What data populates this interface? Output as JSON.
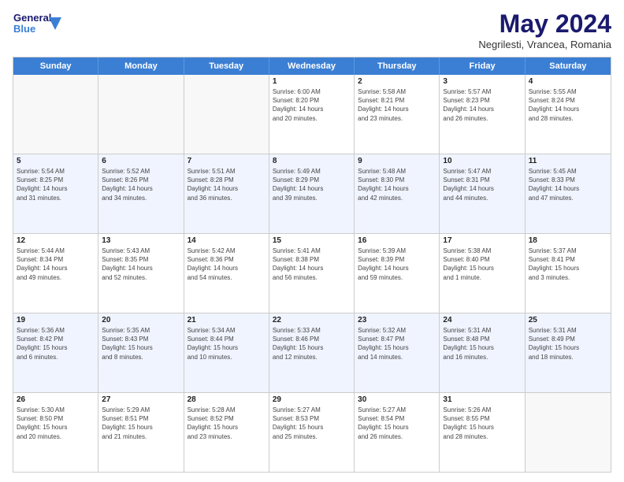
{
  "logo": {
    "line1": "General",
    "line2": "Blue"
  },
  "title": "May 2024",
  "subtitle": "Negrilesti, Vrancea, Romania",
  "days": [
    "Sunday",
    "Monday",
    "Tuesday",
    "Wednesday",
    "Thursday",
    "Friday",
    "Saturday"
  ],
  "weeks": [
    [
      {
        "date": "",
        "info": ""
      },
      {
        "date": "",
        "info": ""
      },
      {
        "date": "",
        "info": ""
      },
      {
        "date": "1",
        "info": "Sunrise: 6:00 AM\nSunset: 8:20 PM\nDaylight: 14 hours\nand 20 minutes."
      },
      {
        "date": "2",
        "info": "Sunrise: 5:58 AM\nSunset: 8:21 PM\nDaylight: 14 hours\nand 23 minutes."
      },
      {
        "date": "3",
        "info": "Sunrise: 5:57 AM\nSunset: 8:23 PM\nDaylight: 14 hours\nand 26 minutes."
      },
      {
        "date": "4",
        "info": "Sunrise: 5:55 AM\nSunset: 8:24 PM\nDaylight: 14 hours\nand 28 minutes."
      }
    ],
    [
      {
        "date": "5",
        "info": "Sunrise: 5:54 AM\nSunset: 8:25 PM\nDaylight: 14 hours\nand 31 minutes."
      },
      {
        "date": "6",
        "info": "Sunrise: 5:52 AM\nSunset: 8:26 PM\nDaylight: 14 hours\nand 34 minutes."
      },
      {
        "date": "7",
        "info": "Sunrise: 5:51 AM\nSunset: 8:28 PM\nDaylight: 14 hours\nand 36 minutes."
      },
      {
        "date": "8",
        "info": "Sunrise: 5:49 AM\nSunset: 8:29 PM\nDaylight: 14 hours\nand 39 minutes."
      },
      {
        "date": "9",
        "info": "Sunrise: 5:48 AM\nSunset: 8:30 PM\nDaylight: 14 hours\nand 42 minutes."
      },
      {
        "date": "10",
        "info": "Sunrise: 5:47 AM\nSunset: 8:31 PM\nDaylight: 14 hours\nand 44 minutes."
      },
      {
        "date": "11",
        "info": "Sunrise: 5:45 AM\nSunset: 8:33 PM\nDaylight: 14 hours\nand 47 minutes."
      }
    ],
    [
      {
        "date": "12",
        "info": "Sunrise: 5:44 AM\nSunset: 8:34 PM\nDaylight: 14 hours\nand 49 minutes."
      },
      {
        "date": "13",
        "info": "Sunrise: 5:43 AM\nSunset: 8:35 PM\nDaylight: 14 hours\nand 52 minutes."
      },
      {
        "date": "14",
        "info": "Sunrise: 5:42 AM\nSunset: 8:36 PM\nDaylight: 14 hours\nand 54 minutes."
      },
      {
        "date": "15",
        "info": "Sunrise: 5:41 AM\nSunset: 8:38 PM\nDaylight: 14 hours\nand 56 minutes."
      },
      {
        "date": "16",
        "info": "Sunrise: 5:39 AM\nSunset: 8:39 PM\nDaylight: 14 hours\nand 59 minutes."
      },
      {
        "date": "17",
        "info": "Sunrise: 5:38 AM\nSunset: 8:40 PM\nDaylight: 15 hours\nand 1 minute."
      },
      {
        "date": "18",
        "info": "Sunrise: 5:37 AM\nSunset: 8:41 PM\nDaylight: 15 hours\nand 3 minutes."
      }
    ],
    [
      {
        "date": "19",
        "info": "Sunrise: 5:36 AM\nSunset: 8:42 PM\nDaylight: 15 hours\nand 6 minutes."
      },
      {
        "date": "20",
        "info": "Sunrise: 5:35 AM\nSunset: 8:43 PM\nDaylight: 15 hours\nand 8 minutes."
      },
      {
        "date": "21",
        "info": "Sunrise: 5:34 AM\nSunset: 8:44 PM\nDaylight: 15 hours\nand 10 minutes."
      },
      {
        "date": "22",
        "info": "Sunrise: 5:33 AM\nSunset: 8:46 PM\nDaylight: 15 hours\nand 12 minutes."
      },
      {
        "date": "23",
        "info": "Sunrise: 5:32 AM\nSunset: 8:47 PM\nDaylight: 15 hours\nand 14 minutes."
      },
      {
        "date": "24",
        "info": "Sunrise: 5:31 AM\nSunset: 8:48 PM\nDaylight: 15 hours\nand 16 minutes."
      },
      {
        "date": "25",
        "info": "Sunrise: 5:31 AM\nSunset: 8:49 PM\nDaylight: 15 hours\nand 18 minutes."
      }
    ],
    [
      {
        "date": "26",
        "info": "Sunrise: 5:30 AM\nSunset: 8:50 PM\nDaylight: 15 hours\nand 20 minutes."
      },
      {
        "date": "27",
        "info": "Sunrise: 5:29 AM\nSunset: 8:51 PM\nDaylight: 15 hours\nand 21 minutes."
      },
      {
        "date": "28",
        "info": "Sunrise: 5:28 AM\nSunset: 8:52 PM\nDaylight: 15 hours\nand 23 minutes."
      },
      {
        "date": "29",
        "info": "Sunrise: 5:27 AM\nSunset: 8:53 PM\nDaylight: 15 hours\nand 25 minutes."
      },
      {
        "date": "30",
        "info": "Sunrise: 5:27 AM\nSunset: 8:54 PM\nDaylight: 15 hours\nand 26 minutes."
      },
      {
        "date": "31",
        "info": "Sunrise: 5:26 AM\nSunset: 8:55 PM\nDaylight: 15 hours\nand 28 minutes."
      },
      {
        "date": "",
        "info": ""
      }
    ]
  ]
}
